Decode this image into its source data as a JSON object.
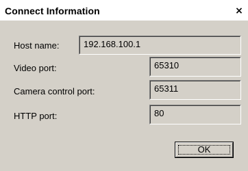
{
  "window": {
    "title": "Connect Information",
    "close_glyph": "×"
  },
  "fields": {
    "host_name": {
      "label": "Host name:",
      "value": "192.168.100.1"
    },
    "video_port": {
      "label": "Video port:",
      "value": "65310"
    },
    "camera_control_port": {
      "label": "Camera control port:",
      "value": "65311"
    },
    "http_port": {
      "label": "HTTP port:",
      "value": "80"
    }
  },
  "buttons": {
    "ok_label": "OK"
  }
}
